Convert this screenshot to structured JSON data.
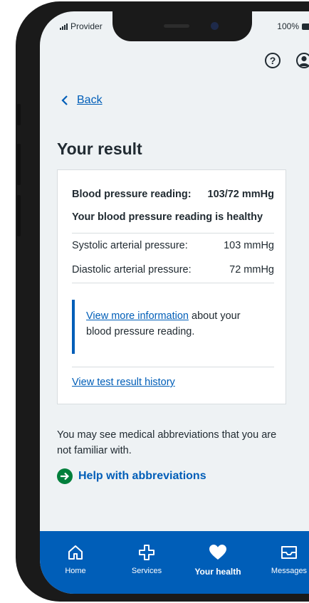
{
  "status_bar": {
    "carrier": "Provider",
    "battery": "100%"
  },
  "back": {
    "label": "Back"
  },
  "page_title": "Your result",
  "result": {
    "reading_label": "Blood pressure reading:",
    "reading_value": "103/72 mmHg",
    "verdict": "Your blood pressure reading is healthy",
    "systolic_label": "Systolic arterial pressure:",
    "systolic_value": "103 mmHg",
    "diastolic_label": "Diastolic arterial pressure:",
    "diastolic_value": "72 mmHg",
    "more_info_link": "View more information",
    "more_info_rest": " about your blood pressure reading.",
    "history_link": "View test result history"
  },
  "abbrev_text": "You may see medical abbreviations that you are not familiar with.",
  "help_link": "Help with abbreviations",
  "nav": {
    "items": [
      {
        "label": "Home",
        "icon": "home-icon"
      },
      {
        "label": "Services",
        "icon": "cross-icon"
      },
      {
        "label": "Your health",
        "icon": "heart-icon",
        "active": true
      },
      {
        "label": "Messages",
        "icon": "inbox-icon"
      }
    ]
  },
  "colors": {
    "brand": "#005eb8",
    "success": "#007f3b",
    "text": "#212b32",
    "background": "#eef2f4"
  }
}
